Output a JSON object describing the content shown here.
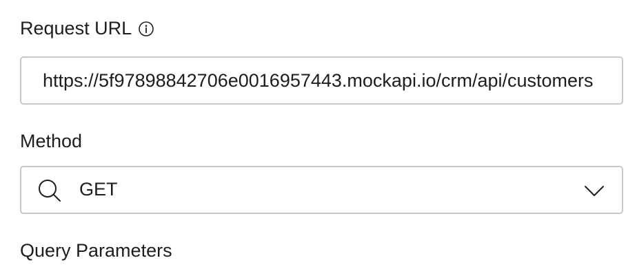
{
  "request_url": {
    "label": "Request URL",
    "info_icon": "info-icon",
    "value": "https://5f97898842706e0016957443.mockapi.io/crm/api/customers"
  },
  "method": {
    "label": "Method",
    "search_icon": "search-icon",
    "selected": "GET",
    "dropdown_icon": "chevron-down-icon"
  },
  "query_parameters": {
    "label": "Query Parameters"
  }
}
